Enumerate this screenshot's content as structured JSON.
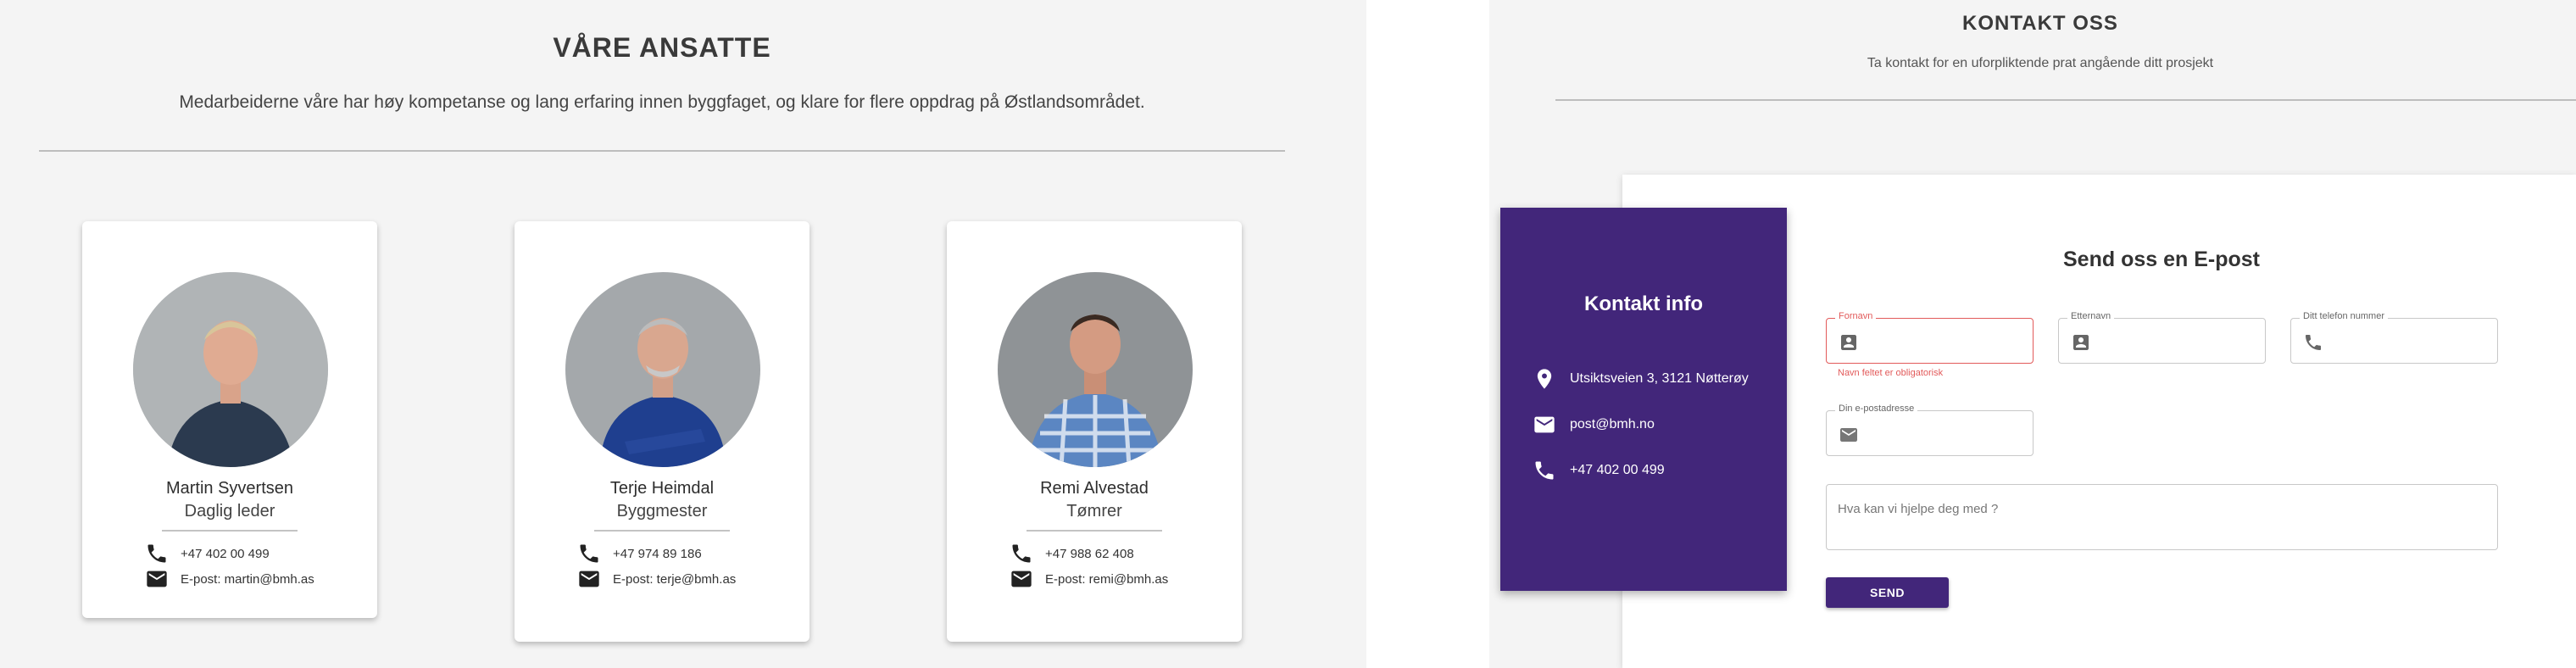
{
  "employees_section": {
    "title": "VÅRE ANSATTE",
    "subtitle": "Medarbeiderne våre har høy kompetanse og lang erfaring innen byggfaget, og klare for flere oppdrag på Østlandsområdet."
  },
  "employees": [
    {
      "name": "Martin Syvertsen",
      "role": "Daglig leder",
      "phone": "+47 402 00 499",
      "email": "E-post: martin@bmh.as",
      "shirt_color": "#2b3a4f"
    },
    {
      "name": "Terje Heimdal",
      "role": "Byggmester",
      "phone": "+47 974 89 186",
      "email": "E-post: terje@bmh.as",
      "shirt_color": "#1f3f8f"
    },
    {
      "name": "Remi Alvestad",
      "role": "Tømrer",
      "phone": "+47 988 62 408",
      "email": "E-post: remi@bmh.as",
      "shirt_color": "#5b86c2"
    }
  ],
  "contact_section": {
    "title": "KONTAKT OSS",
    "subtitle": "Ta kontakt for en uforpliktende prat angående ditt prosjekt"
  },
  "contact_info": {
    "title": "Kontakt info",
    "address": "Utsiktsveien 3, 3121 Nøtterøy",
    "email": "post@bmh.no",
    "phone": "+47 402 00 499"
  },
  "form": {
    "title": "Send oss en E-post",
    "first_name_label": "Fornavn",
    "first_name_error": "Navn feltet er obligatorisk",
    "last_name_label": "Etternavn",
    "phone_label": "Ditt telefon nummer",
    "email_label": "Din e-postadresse",
    "message_placeholder": "Hva kan vi hjelpe deg med ?",
    "send_label": "SEND"
  },
  "colors": {
    "accent": "#42267a",
    "error": "#e25a5a",
    "background": "#f4f4f4"
  },
  "icons": [
    "phone-icon",
    "mail-icon",
    "location-icon",
    "person-card-icon"
  ]
}
